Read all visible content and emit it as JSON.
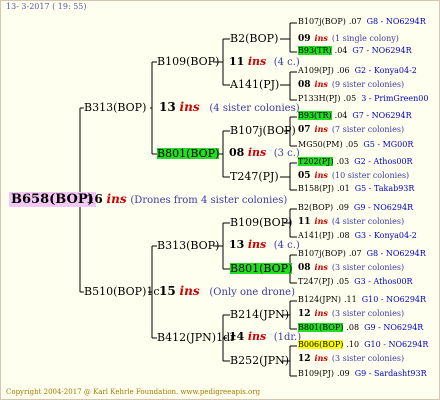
{
  "header": {
    "date": "13-  3-2017 ( 19: 55)"
  },
  "footer": {
    "copyright": "Copyright 2004-2017 @ Karl Kehrle Foundation.   www.pedigreeapis.org"
  },
  "ins_word": "ins",
  "root": {
    "label": "B658(BOP)",
    "count": "16",
    "desc": "(Drones from 4 sister colonies)"
  },
  "gen1": [
    {
      "label": "B313(BOP)",
      "count": "13",
      "desc": "(4 sister colonies)"
    },
    {
      "label": "B510(BOP)1c",
      "count": "15",
      "desc": "(Only one drone)"
    }
  ],
  "gen2": [
    {
      "label": "B109(BOP)"
    },
    {
      "label": "B801(BOP)",
      "count": "08",
      "desc": "(3 c.)"
    },
    {
      "label": "B313(BOP)",
      "count": "13",
      "desc": "(4 c.)"
    },
    {
      "label": "B412(JPN)1dr",
      "count": "14",
      "desc": "(1dr.)"
    }
  ],
  "gen3": [
    {
      "label": "B2(BOP)",
      "count": "11",
      "desc": "(4 c.)"
    },
    {
      "label": "A141(PJ)"
    },
    {
      "label": "B107j(BOP)"
    },
    {
      "label": "T247(PJ)"
    },
    {
      "label": "B109(BOP)"
    },
    {
      "label": "B801(BOP)"
    },
    {
      "label": "B214(JPN)"
    },
    {
      "label": "B252(JPN)"
    }
  ],
  "gen4": [
    {
      "label": "B107j(BOP)",
      "yr": ".07",
      "code": "G8 - NO6294R"
    },
    {
      "count": "09",
      "desc": "(1 single colony)"
    },
    {
      "label": "B93(TR)",
      "yr": ".04",
      "code": "G7 - NO6294R"
    },
    {
      "label": "A109(PJ)",
      "yr": ".06",
      "code": "G2 - Konya04-2"
    },
    {
      "count": "08",
      "desc": "(9 sister colonies)"
    },
    {
      "label": "P133H(PJ)",
      "yr": ".05",
      "code": "3 - PrimGreen00"
    },
    {
      "label": "B93(TR)",
      "yr": ".04",
      "code": "G7 - NO6294R"
    },
    {
      "count": "07",
      "desc": "(7 sister colonies)"
    },
    {
      "label": "MG50(PM)",
      "yr": ".05",
      "code": "G5 - MG00R"
    },
    {
      "label": "T202(PJ)",
      "yr": ".03",
      "code": "G2 - Athos00R"
    },
    {
      "count": "05",
      "desc": "(10 sister colonies)"
    },
    {
      "label": "B158(PJ)",
      "yr": ".01",
      "code": "G5 - Takab93R"
    },
    {
      "label": "B2(BOP)",
      "yr": ".09",
      "code": "G9 - NO6294R"
    },
    {
      "count": "11",
      "desc": "(4 sister colonies)"
    },
    {
      "label": "A141(PJ)",
      "yr": ".08",
      "code": "G3 - Konya04-2"
    },
    {
      "label": "B107j(BOP)",
      "yr": ".07",
      "code": "G8 - NO6294R"
    },
    {
      "count": "08",
      "desc": "(3 sister colonies)"
    },
    {
      "label": "T247(PJ)",
      "yr": ".05",
      "code": "G3 - Athos00R"
    },
    {
      "label": "B124(JPN)",
      "yr": ".11",
      "code": "G10 - NO6294R"
    },
    {
      "count": "12",
      "desc": "(3 sister colonies)"
    },
    {
      "label": "B801(BOP)",
      "yr": ".08",
      "code": "G9 - NO6294R"
    },
    {
      "label": "B006(BOP)",
      "yr": ".10",
      "code": "G10 - NO6294R"
    },
    {
      "count": "12",
      "desc": "(3 sister colonies)"
    },
    {
      "label": "B109(PJ)",
      "yr": ".09",
      "code": "G9 - Sardasht93R"
    }
  ]
}
